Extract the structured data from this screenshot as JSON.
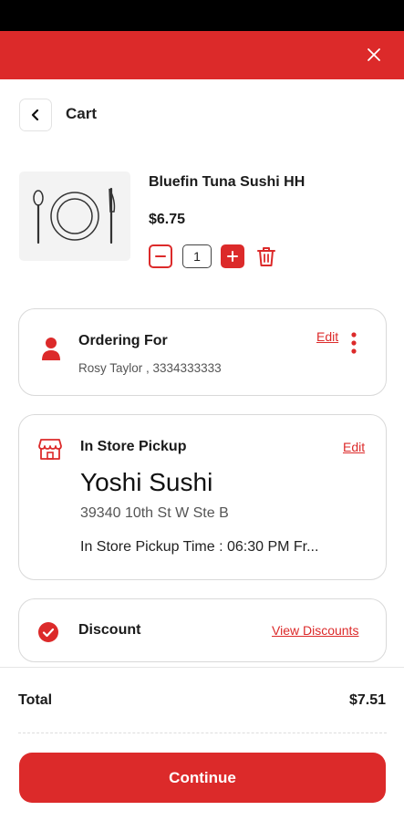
{
  "header": {
    "close_icon": "close-icon",
    "background_color": "#dc2a2a"
  },
  "cart": {
    "title": "Cart",
    "back_icon": "chevron-left-icon"
  },
  "item": {
    "name": "Bluefin Tuna Sushi HH",
    "price": "$6.75",
    "quantity": "1",
    "image_icon": "plate-cutlery-icon"
  },
  "ordering_for": {
    "title": "Ordering For",
    "details": "Rosy Taylor , 3334333333",
    "edit_label": "Edit",
    "icon": "person-icon",
    "more_icon": "more-vertical-icon"
  },
  "pickup": {
    "title": "In Store Pickup",
    "edit_label": "Edit",
    "store_name": "Yoshi Sushi",
    "address": "39340 10th St W Ste B",
    "time": "In Store Pickup Time : 06:30 PM Fr...",
    "icon": "store-icon"
  },
  "discount": {
    "title": "Discount",
    "link_label": "View Discounts",
    "icon": "check-circle-icon"
  },
  "summary": {
    "total_label": "Total",
    "total_value": "$7.51"
  },
  "actions": {
    "continue_label": "Continue"
  }
}
